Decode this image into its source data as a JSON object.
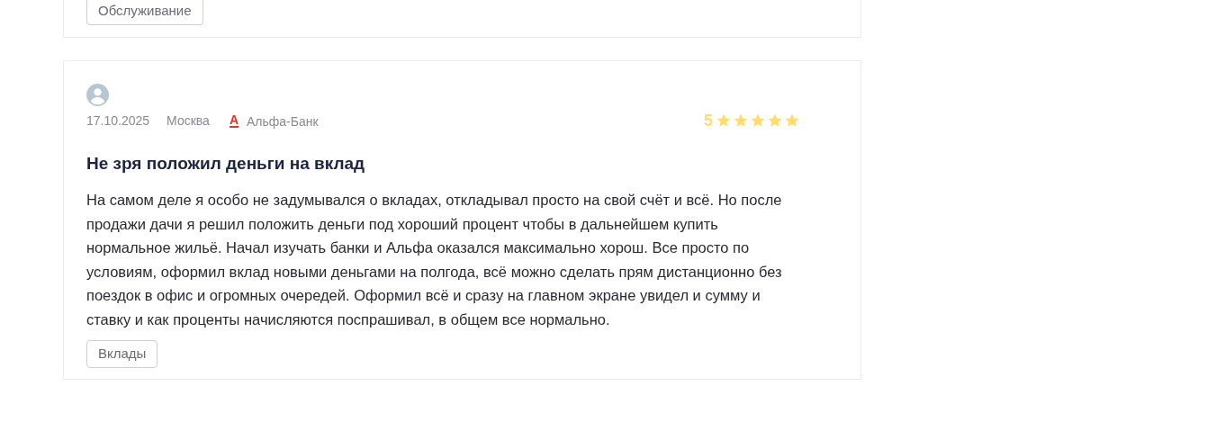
{
  "reviews": [
    {
      "tags": [
        "Обслуживание"
      ]
    },
    {
      "date": "17.10.2025",
      "city": "Москва",
      "bank": {
        "logo": "А",
        "name": "Альфа-Банк"
      },
      "rating": "5",
      "stars": 5,
      "title": "Не зря положил деньги на вклад",
      "text": "На самом деле я особо не задумывался о вкладах, откладывал просто на свой счёт и всё. Но после продажи дачи я решил положить деньги под хороший процент чтобы в дальнейшем купить нормальное жильё. Начал изучать банки и Альфа оказался максимально хорош. Все просто по условиям, оформил вклад новыми деньгами на полгода, всё можно сделать прям дистанционно без поездок в офис и огромных очередей. Оформил всё и сразу на главном экране увидел и сумму и ставку и как проценты начисляются поспрашивал, в общем все нормально.",
      "tags": [
        "Вклады"
      ]
    }
  ]
}
